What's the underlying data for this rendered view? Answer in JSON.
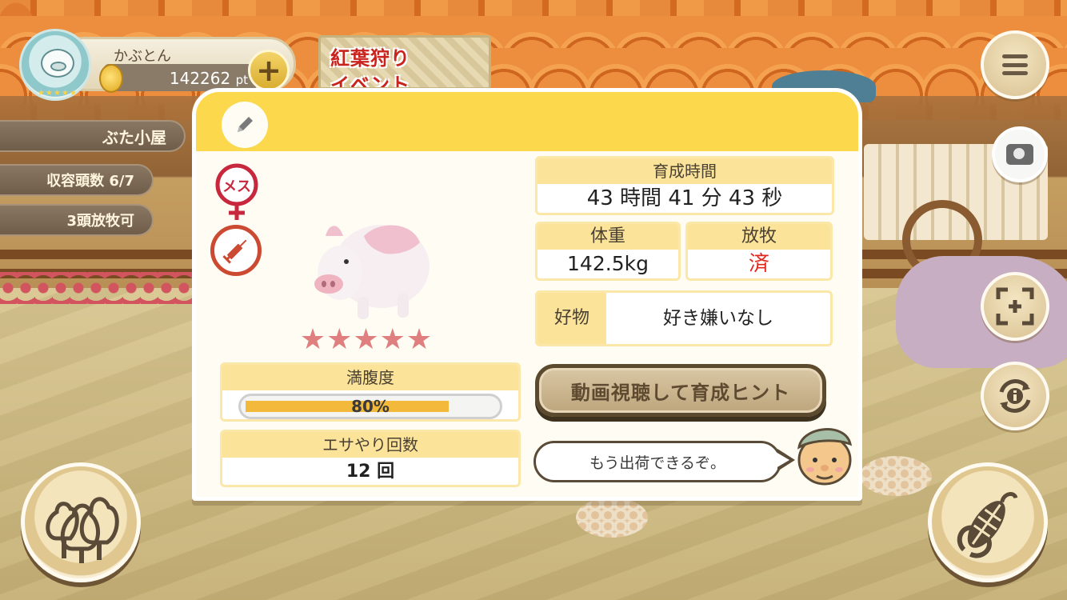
{
  "event_banner": {
    "line1": "紅葉狩り",
    "line2": "イベント"
  },
  "player": {
    "name": "かぶとん",
    "points": "142262",
    "points_unit": "pt"
  },
  "side_panel": {
    "location": "ぶた小屋",
    "capacity": "収容頭数 6/7",
    "release_available": "3頭放牧可"
  },
  "pig_detail": {
    "sex_badge": "メス",
    "rating_stars": 5,
    "stars_text": "★★★★★",
    "fullness": {
      "label": "満腹度",
      "value": "80%",
      "percent": 80
    },
    "feed_count": {
      "label": "エサやり回数",
      "value": "12 回"
    },
    "raising_time": {
      "label": "育成時間",
      "value": "43 時間 41 分 43 秒"
    },
    "weight": {
      "label": "体重",
      "value": "142.5kg"
    },
    "grazing": {
      "label": "放牧",
      "value": "済"
    },
    "favorite": {
      "label": "好物",
      "value": "好き嫌いなし"
    },
    "hint_button_label": "動画視聴して育成ヒント",
    "farmer_message": "もう出荷できるぞ。"
  },
  "icons": {
    "menu": "menu-icon",
    "camera": "camera-icon",
    "focus": "focus-icon",
    "info_rotate": "info-rotate-icon",
    "forest": "trees-icon",
    "feed": "corn-icon",
    "edit": "pencil-icon",
    "vaccine": "syringe-icon"
  },
  "colors": {
    "header_yellow": "#fbd84c",
    "label_yellow": "#fbe49a",
    "star_pink": "#df7f7f",
    "grazing_done_red": "#e0261e",
    "progress_orange": "#f2b93a"
  }
}
